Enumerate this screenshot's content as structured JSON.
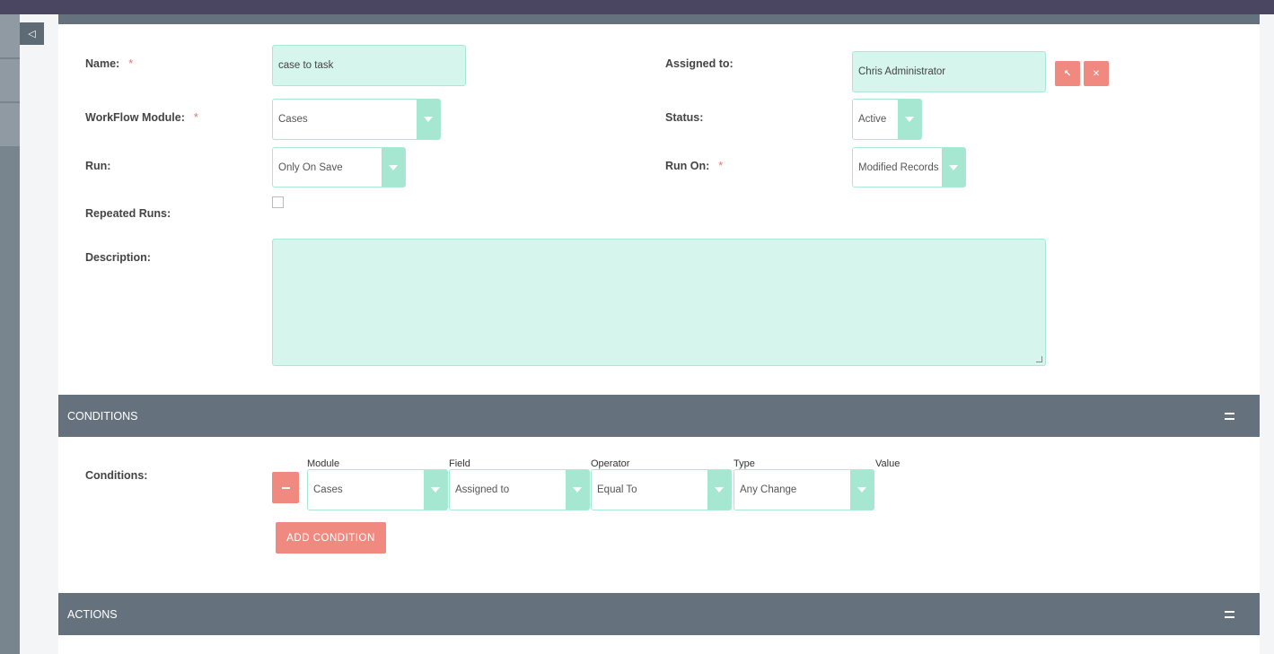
{
  "form": {
    "name_label": "Name:",
    "name_value": "case to task",
    "required_mark": "*",
    "assigned_label": "Assigned to:",
    "assigned_value": "Chris Administrator",
    "module_label": "WorkFlow Module:",
    "module_value": "Cases",
    "status_label": "Status:",
    "status_value": "Active",
    "run_label": "Run:",
    "run_value": "Only On Save",
    "run_on_label": "Run On:",
    "run_on_value": "Modified Records",
    "repeated_label": "Repeated Runs:",
    "description_label": "Description:"
  },
  "conditions": {
    "section_title": "CONDITIONS",
    "row_label": "Conditions:",
    "columns": [
      "Module",
      "Field",
      "Operator",
      "Type",
      "Value"
    ],
    "row": {
      "module": "Cases",
      "field": "Assigned to",
      "operator": "Equal To",
      "type": "Any Change"
    },
    "add_label": "ADD CONDITION"
  },
  "actions": {
    "section_title": "ACTIONS"
  },
  "icons": {
    "collapse": "◁",
    "select_user": "↖",
    "clear": "✕"
  },
  "colors": {
    "accent_field": "#d6f5ec",
    "accent_arrow": "#a6e7d2",
    "button": "#f08a80",
    "section_bar": "#65727d"
  }
}
